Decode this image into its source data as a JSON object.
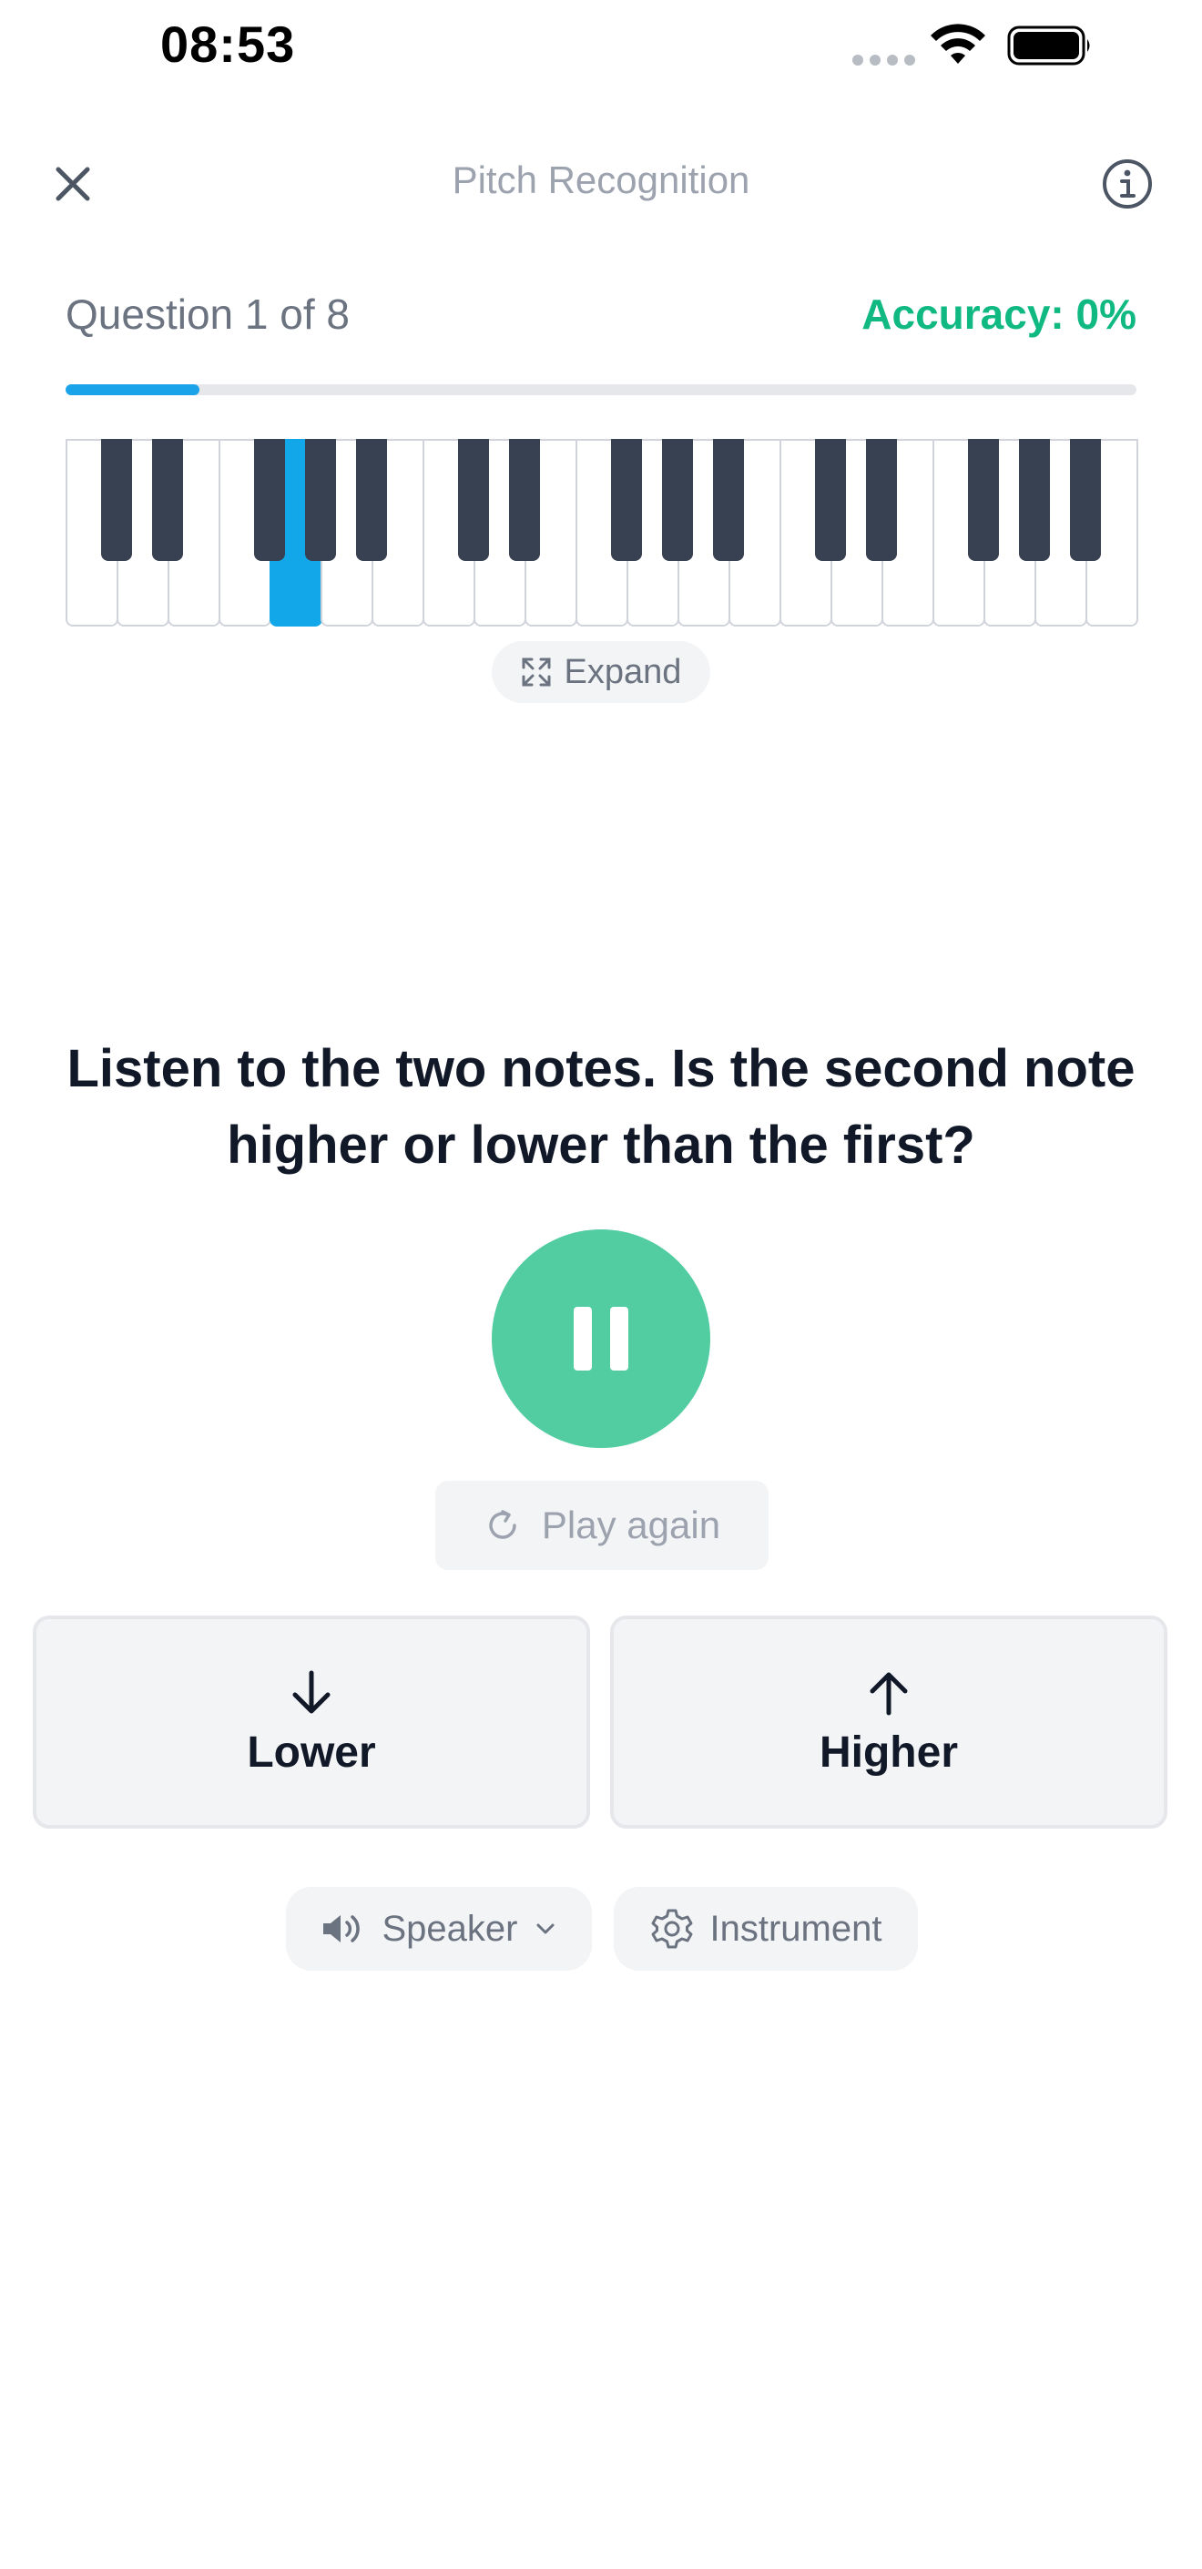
{
  "status_bar": {
    "time": "08:53"
  },
  "header": {
    "title": "Pitch Recognition"
  },
  "progress": {
    "question_label": "Question 1 of 8",
    "accuracy_label": "Accuracy: 0%",
    "fraction": 0.125
  },
  "piano": {
    "white_key_count": 21,
    "active_white_key": 4,
    "black_key_after_white": [
      0,
      1,
      3,
      4,
      5,
      7,
      8,
      10,
      11,
      12,
      14,
      15,
      17,
      18,
      19
    ]
  },
  "expand_label": "Expand",
  "prompt": "Listen to the two notes. Is the second note higher or lower than the first?",
  "play_again_label": "Play again",
  "answers": {
    "lower_label": "Lower",
    "higher_label": "Higher"
  },
  "options": {
    "speaker_label": "Speaker",
    "instrument_label": "Instrument"
  },
  "colors": {
    "accent_blue": "#1aa3e8",
    "accent_green": "#10b981",
    "play_button": "#52cca1"
  }
}
